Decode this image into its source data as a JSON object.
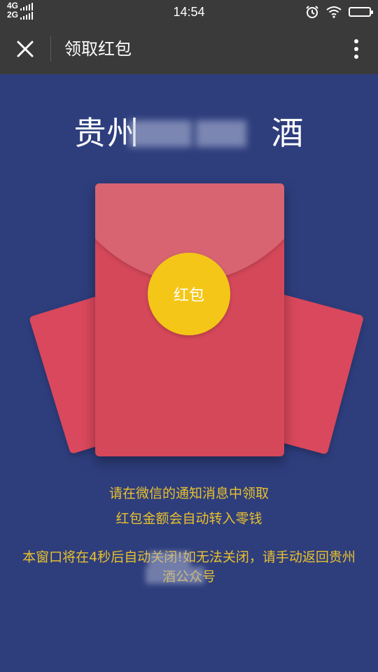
{
  "status_bar": {
    "network_top": "4G",
    "network_bottom": "2G",
    "time": "14:54",
    "icons": [
      "alarm-icon",
      "wifi-icon",
      "battery-icon"
    ]
  },
  "title_bar": {
    "title": "领取红包",
    "close_icon": "close-icon",
    "more_icon": "more-vertical-icon"
  },
  "brand": {
    "title": "贵州　　　　酒"
  },
  "envelope": {
    "button_label": "红包",
    "colors": {
      "background": "#2e3e7d",
      "envelope": "#d5485a",
      "flap": "#d86472",
      "button": "#f4c617",
      "text_accent": "#e9c12d"
    }
  },
  "instructions": {
    "line1": "请在微信的通知消息中领取",
    "line2": "红包金额会自动转入零钱",
    "notice": "本窗口将在4秒后自动关闭!如无法关闭，请手动返回贵州　　　酒公众号"
  }
}
